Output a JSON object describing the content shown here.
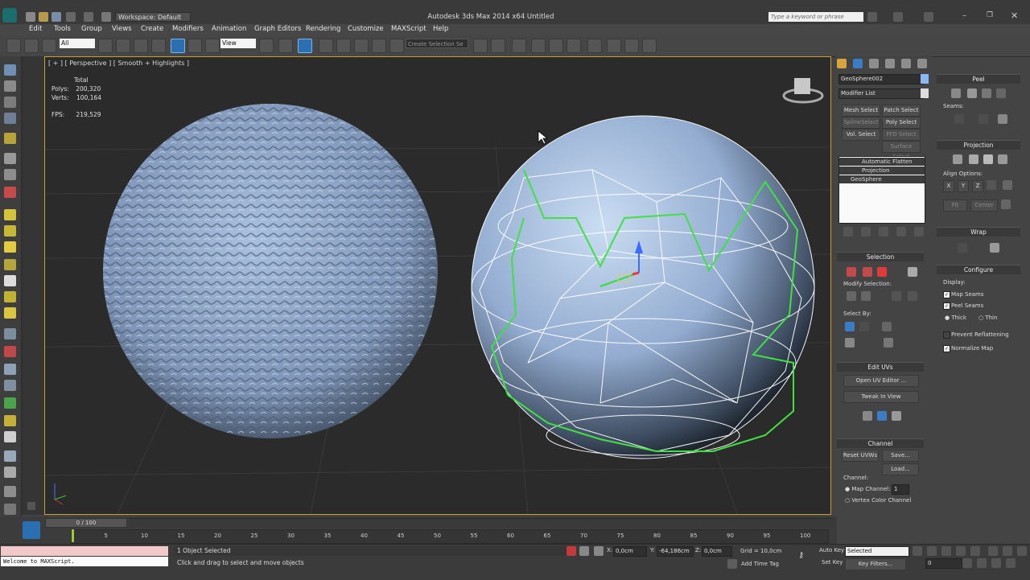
{
  "window": {
    "title": "Autodesk 3ds Max  2014 x64    Untitled",
    "workspace": "Workspace: Default",
    "search_placeholder": "Type a keyword or phrase"
  },
  "menu": [
    "Edit",
    "Tools",
    "Group",
    "Views",
    "Create",
    "Modifiers",
    "Animation",
    "Graph Editors",
    "Rendering",
    "Customize",
    "MAXScript",
    "Help"
  ],
  "toolbar": {
    "selection_filter": "All",
    "reference_coord": "View",
    "named_selection": "Create Selection Se"
  },
  "viewport": {
    "label": "[ + ] [ Perspective ] [ Smooth + Highlights ]",
    "stats": {
      "total_label": "Total",
      "polys_label": "Polys:",
      "polys": "200,320",
      "verts_label": "Verts:",
      "verts": "100,164",
      "fps_label": "FPS:",
      "fps": "219,529"
    }
  },
  "command_panel": {
    "object_name": "GeoSphere002",
    "modifier_list": "Modifier List",
    "quick_buttons": [
      "Mesh Select",
      "Patch Select",
      "SplineSelect",
      "Poly Select",
      "Vol. Select",
      "FFD Select",
      "Surface Select"
    ],
    "stack": [
      "Automatic Flatten UVs",
      "Projection",
      "GeoSphere"
    ],
    "selection": {
      "title": "Selection",
      "modify_label": "Modify Selection:",
      "select_by": "Select By:"
    },
    "edit_uvs": {
      "title": "Edit UVs",
      "open_editor": "Open UV Editor ...",
      "tweak": "Tweak In View"
    },
    "channel": {
      "title": "Channel",
      "reset": "Reset UVWs",
      "save": "Save...",
      "load": "Load...",
      "channel_label": "Channel:",
      "map_channel": "Map Channel:",
      "map_channel_value": "1",
      "vertex_color": "Vertex Color Channel"
    }
  },
  "right_panel": {
    "peel": {
      "title": "Peel",
      "seams": "Seams:"
    },
    "projection": {
      "title": "Projection",
      "align": "Align Options:",
      "axes": [
        "X",
        "Y",
        "Z"
      ],
      "fit": "Fit",
      "center": "Center"
    },
    "wrap": {
      "title": "Wrap"
    },
    "configure": {
      "title": "Configure",
      "display": "Display:",
      "map_seams": "Map Seams",
      "peel_seams": "Peel Seams",
      "thick": "Thick",
      "thin": "Thin",
      "prevent": "Prevent Reflattening",
      "normalize": "Normalize Map"
    }
  },
  "timeline": {
    "frame_display": "0 / 100",
    "ticks": [
      "5",
      "10",
      "15",
      "20",
      "25",
      "30",
      "35",
      "40",
      "45",
      "50",
      "55",
      "60",
      "65",
      "70",
      "75",
      "80",
      "85",
      "90",
      "95",
      "100"
    ]
  },
  "status": {
    "maxscript": "Welcome to MAXScript.",
    "objects_selected": "1 Object Selected",
    "prompt": "Click and drag to select and move objects",
    "x_label": "X:",
    "x": "0,0cm",
    "y_label": "Y:",
    "y": "-64,186cm",
    "z_label": "Z:",
    "z": "0,0cm",
    "grid": "Grid = 10,0cm",
    "add_time_tag": "Add Time Tag",
    "auto_key": "Auto Key",
    "set_key": "Set Key",
    "key_mode": "Selected",
    "key_filters": "Key Filters...",
    "frame": "0"
  },
  "colors": {
    "viewport_bg": "#2b2b2b",
    "sphere_blue": "#9cb4d6",
    "seam_green": "#3fe23f",
    "active_border": "#c8a030"
  }
}
